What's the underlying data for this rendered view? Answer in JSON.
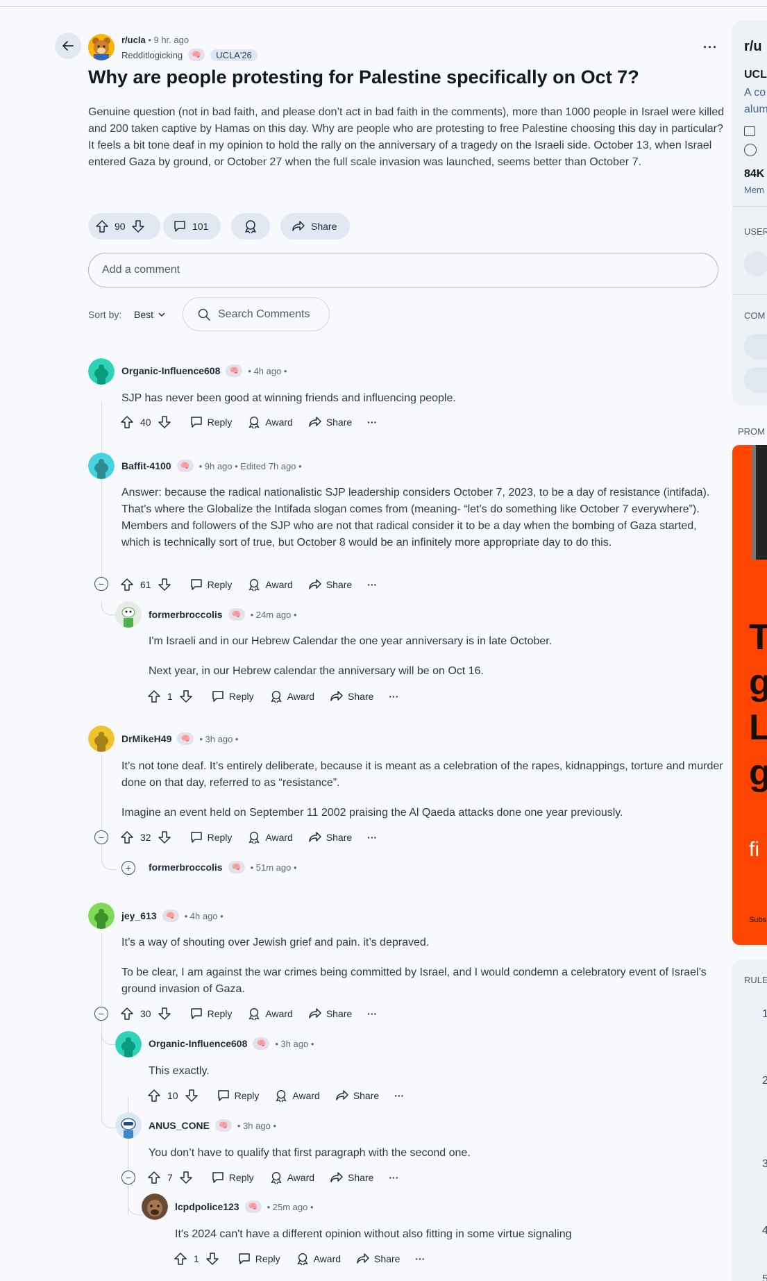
{
  "post": {
    "subreddit": "r/ucla",
    "time": "• 9 hr. ago",
    "author": "Redditlogicking",
    "author_flair": "UCLA'26",
    "title": "Why are people protesting for Palestine specifically on Oct 7?",
    "body": "Genuine question (not in bad faith, and please don’t act in bad faith in the comments), more than 1000 people in Israel were killed and 200 taken captive by Hamas on this day. Why are people who are protesting to free Palestine choosing this day in particular? It feels a bit tone deaf in my opinion to hold the rally on the anniversary of a tragedy on the Israeli side. October 13, when Israel entered Gaza by ground, or October 27 when the full scale invasion was launched, seems better than October 7.",
    "votes": "90",
    "comments": "101",
    "share_label": "Share"
  },
  "add_comment_placeholder": "Add a comment",
  "sort": {
    "label": "Sort by:",
    "value": "Best"
  },
  "search_comments_placeholder": "Search Comments",
  "labels": {
    "reply": "Reply",
    "award": "Award",
    "share": "Share"
  },
  "comments": [
    {
      "author": "Organic-Influence608",
      "meta": "• 4h ago •",
      "text": [
        "SJP has never been good at winning friends and influencing people."
      ],
      "votes": "40"
    },
    {
      "author": "Baffit-4100",
      "meta": "• 9h ago • Edited 7h ago •",
      "text": [
        "Answer: because the radical nationalistic SJP leadership considers October 7, 2023, to be a day of resistance (intifada). That’s where the Globalize the Intifada slogan comes from (meaning- “let’s do something like October 7 everywhere”). Members and followers of the SJP who are not that radical consider it to be a day when the bombing of Gaza started, which is technically sort of true, but October 8 would be an infinitely more appropriate day to do this."
      ],
      "votes": "61"
    },
    {
      "author": "formerbroccolis",
      "meta": "• 24m ago •",
      "text": [
        "I'm Israeli and in our Hebrew Calendar the one year anniversary is in late October.",
        "Next year, in our Hebrew calendar the anniversary will be on Oct 16."
      ],
      "votes": "1"
    },
    {
      "author": "DrMikeH49",
      "meta": "• 3h ago •",
      "text": [
        "It’s not tone deaf. It’s entirely deliberate, because it is meant as a celebration of the rapes, kidnappings, torture and murder done on that day, referred to as “resistance”.",
        "Imagine an event held on September 11 2002 praising the Al Qaeda attacks done one year previously."
      ],
      "votes": "32"
    },
    {
      "author": "formerbroccolis",
      "meta": "• 51m ago •",
      "text": [],
      "votes": ""
    },
    {
      "author": "jey_613",
      "meta": "• 4h ago •",
      "text": [
        "It’s a way of shouting over Jewish grief and pain. it’s depraved.",
        "To be clear, I am against the war crimes being committed by Israel, and I would condemn a celebratory event of Israel’s ground invasion of Gaza."
      ],
      "votes": "30"
    },
    {
      "author": "Organic-Influence608",
      "meta": "• 3h ago •",
      "text": [
        "This exactly."
      ],
      "votes": "10"
    },
    {
      "author": "ANUS_CONE",
      "meta": "• 3h ago •",
      "text": [
        "You don’t have to qualify that first paragraph with the second one."
      ],
      "votes": "7"
    },
    {
      "author": "lcpdpolice123",
      "meta": "• 25m ago •",
      "text": [
        "It's 2024 can't have a different opinion without also fitting in some virtue signaling"
      ],
      "votes": "1"
    }
  ],
  "sidebar": {
    "title_partial": "r/u",
    "sub_partial": "UCL",
    "desc_partial": "A co",
    "desc_partial2": "alum",
    "members_partial": "84K",
    "members_label_partial": "Mem",
    "users_partial": "USER",
    "comm_partial": "COM",
    "promoted_partial": "PROM",
    "ad_big_1": "T",
    "ad_big_2": "g",
    "ad_big_3": "L",
    "ad_big_4": "g",
    "ad_small": "fi",
    "ad_sub": "Subs",
    "rules_partial": "RULE",
    "rule_nums": [
      "1",
      "2",
      "3",
      "4",
      "5"
    ]
  },
  "colors": {
    "accent": "#ff4500",
    "background": "#f7f9fc",
    "pill": "#e2e8f1"
  }
}
